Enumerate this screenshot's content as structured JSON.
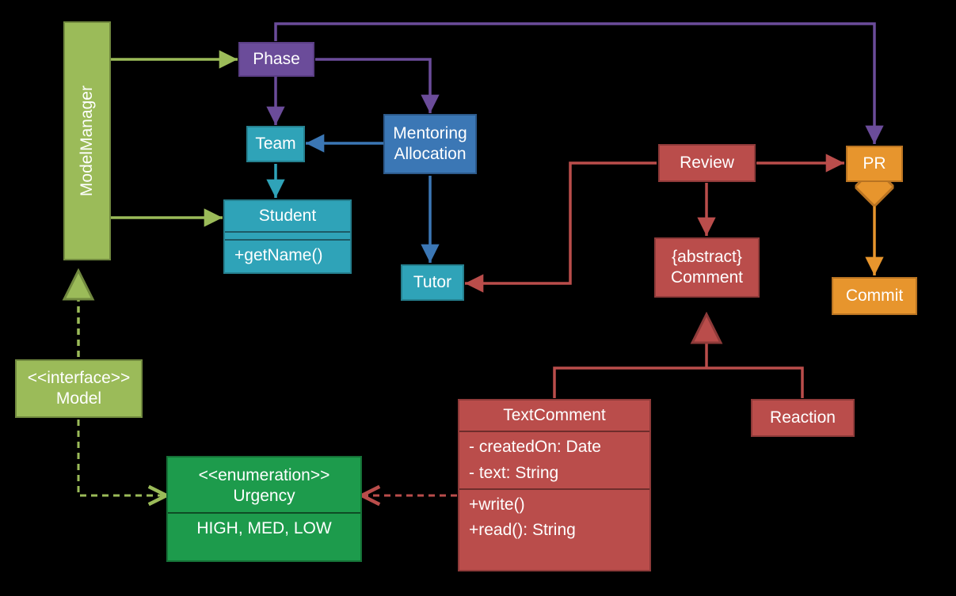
{
  "nodes": {
    "modelManager": {
      "title": "ModelManager"
    },
    "phase": {
      "title": "Phase"
    },
    "team": {
      "title": "Team"
    },
    "mentoring": {
      "line1": "Mentoring",
      "line2": "Allocation"
    },
    "student": {
      "title": "Student",
      "method": "+getName()"
    },
    "tutor": {
      "title": "Tutor"
    },
    "model": {
      "stereo": "<<interface>>",
      "title": "Model"
    },
    "urgency": {
      "stereo": "<<enumeration>>",
      "title": "Urgency",
      "values": "HIGH, MED, LOW"
    },
    "review": {
      "title": "Review"
    },
    "comment": {
      "stereo": "{abstract}",
      "title": "Comment"
    },
    "textComment": {
      "title": "TextComment",
      "f1": "- createdOn: Date",
      "f2": "- text: String",
      "m1": "+write()",
      "m2": "+read(): String"
    },
    "reaction": {
      "title": "Reaction"
    },
    "pr": {
      "title": "PR"
    },
    "commit": {
      "title": "Commit"
    }
  },
  "colors": {
    "olive": "#9BBB59",
    "purple": "#6b4c9a",
    "blue": "#3b77b5",
    "cyan": "#2fa3b8",
    "red": "#ba4d4b",
    "orange": "#e7952d",
    "green": "#1d9b4c"
  }
}
